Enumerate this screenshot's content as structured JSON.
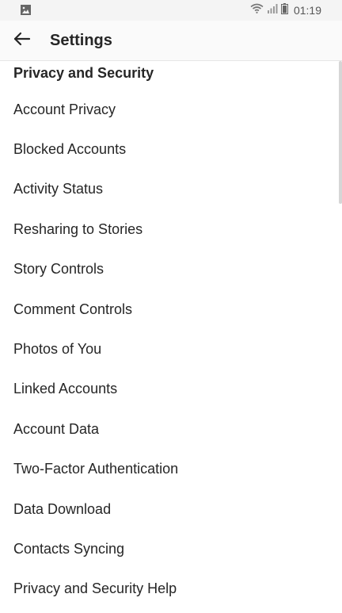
{
  "status_bar": {
    "time": "01:19",
    "icons": [
      "image-icon",
      "wifi-icon",
      "signal-icon",
      "battery-icon"
    ]
  },
  "header": {
    "back_icon": "arrow-left-icon",
    "title": "Settings"
  },
  "section": {
    "title": "Privacy and Security"
  },
  "items": [
    {
      "label": "Account Privacy"
    },
    {
      "label": "Blocked Accounts"
    },
    {
      "label": "Activity Status"
    },
    {
      "label": "Resharing to Stories"
    },
    {
      "label": "Story Controls"
    },
    {
      "label": "Comment Controls"
    },
    {
      "label": "Photos of You"
    },
    {
      "label": "Linked Accounts"
    },
    {
      "label": "Account Data"
    },
    {
      "label": "Two-Factor Authentication"
    },
    {
      "label": "Data Download"
    },
    {
      "label": "Contacts Syncing"
    },
    {
      "label": "Privacy and Security Help"
    }
  ],
  "colors": {
    "text": "#262626",
    "status_bar_bg": "#f4f4f4",
    "app_bar_bg": "#fafafa",
    "divider": "#e6e6e6"
  }
}
